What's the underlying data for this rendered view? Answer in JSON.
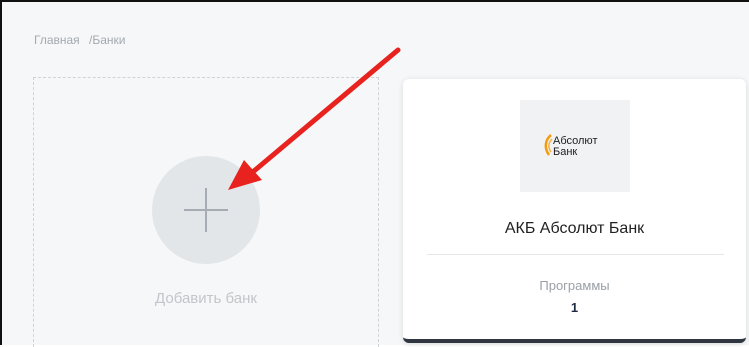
{
  "breadcrumb": {
    "home": "Главная",
    "separator": "/",
    "current": "Банки"
  },
  "add_card": {
    "label": "Добавить банк",
    "icon": "plus-icon"
  },
  "bank_card": {
    "logo_line1": "Абсолют",
    "logo_line2": "Банк",
    "name": "АКБ Абсолют Банк",
    "programs_label": "Программы",
    "programs_count": "1"
  },
  "annotation": {
    "icon": "red-arrow-icon",
    "color": "#e8221e"
  },
  "colors": {
    "accent_bar": "#2f3640",
    "logo_orange": "#f39c12"
  }
}
